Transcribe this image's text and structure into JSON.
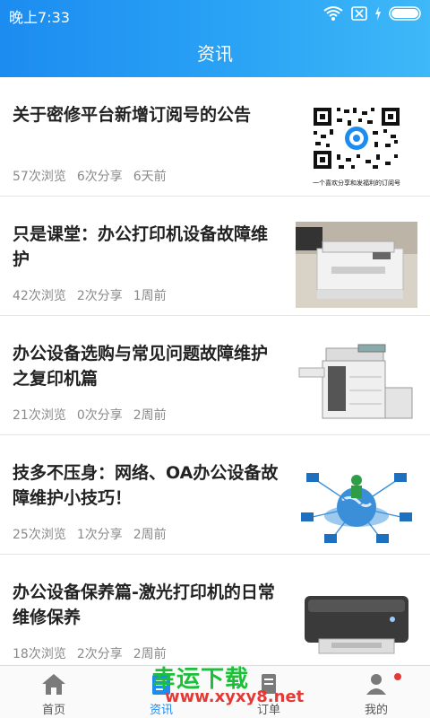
{
  "status_bar": {
    "time": "晚上7:33"
  },
  "header": {
    "title": "资讯"
  },
  "articles": [
    {
      "title": "关于密修平台新增订阅号的公告",
      "views": "57次浏览",
      "shares": "6次分享",
      "time": "6天前",
      "thumb_caption": "一个喜欢分享和发福利的订阅号"
    },
    {
      "title": "只是课堂：办公打印机设备故障维护",
      "views": "42次浏览",
      "shares": "2次分享",
      "time": "1周前"
    },
    {
      "title": "办公设备选购与常见问题故障维护之复印机篇",
      "views": "21次浏览",
      "shares": "0次分享",
      "time": "2周前"
    },
    {
      "title": "技多不压身：网络、OA办公设备故障维护小技巧！",
      "views": "25次浏览",
      "shares": "1次分享",
      "time": "2周前"
    },
    {
      "title": "办公设备保养篇-激光打印机的日常维修保养",
      "views": "18次浏览",
      "shares": "2次分享",
      "time": "2周前"
    }
  ],
  "bottom_nav": {
    "tabs": [
      {
        "label": "首页",
        "icon": "home-icon"
      },
      {
        "label": "资讯",
        "icon": "news-icon"
      },
      {
        "label": "订单",
        "icon": "order-icon"
      },
      {
        "label": "我的",
        "icon": "profile-icon"
      }
    ],
    "active": "资讯"
  },
  "watermark": {
    "main": "幸运下载",
    "sub": "www.xyxy8.net"
  },
  "colors": {
    "accent": "#1c8cf0",
    "watermark_green": "#1bbf38",
    "watermark_red": "#e53935"
  }
}
